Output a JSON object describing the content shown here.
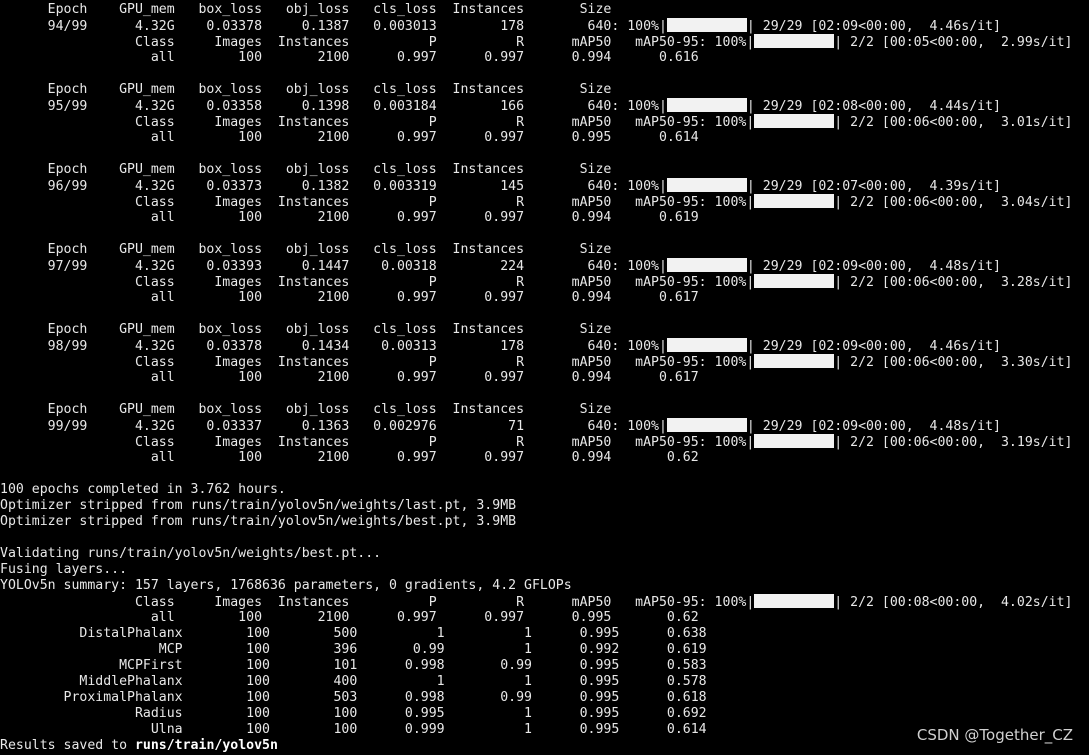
{
  "lines": [
    {
      "text": "      Epoch    GPU_mem   box_loss   obj_loss   cls_loss  Instances       Size"
    },
    {
      "text": "      94/99      4.32G    0.03378     0.1387   0.003013        178        640: 100%|",
      "bar": true,
      "suffix": "| 29/29 [02:09<00:00,  4.46s/it]"
    },
    {
      "text": "                 Class     Images  Instances          P          R      mAP50   mAP50-95: 100%|",
      "bar": true,
      "suffix": "| 2/2 [00:05<00:00,  2.99s/it]"
    },
    {
      "text": "                   all        100       2100      0.997      0.997      0.994      0.616"
    },
    {
      "text": ""
    },
    {
      "text": "      Epoch    GPU_mem   box_loss   obj_loss   cls_loss  Instances       Size"
    },
    {
      "text": "      95/99      4.32G    0.03358     0.1398   0.003184        166        640: 100%|",
      "bar": true,
      "suffix": "| 29/29 [02:08<00:00,  4.44s/it]"
    },
    {
      "text": "                 Class     Images  Instances          P          R      mAP50   mAP50-95: 100%|",
      "bar": true,
      "suffix": "| 2/2 [00:06<00:00,  3.01s/it]"
    },
    {
      "text": "                   all        100       2100      0.997      0.997      0.995      0.614"
    },
    {
      "text": ""
    },
    {
      "text": "      Epoch    GPU_mem   box_loss   obj_loss   cls_loss  Instances       Size"
    },
    {
      "text": "      96/99      4.32G    0.03373     0.1382   0.003319        145        640: 100%|",
      "bar": true,
      "suffix": "| 29/29 [02:07<00:00,  4.39s/it]"
    },
    {
      "text": "                 Class     Images  Instances          P          R      mAP50   mAP50-95: 100%|",
      "bar": true,
      "suffix": "| 2/2 [00:06<00:00,  3.04s/it]"
    },
    {
      "text": "                   all        100       2100      0.997      0.997      0.994      0.619"
    },
    {
      "text": ""
    },
    {
      "text": "      Epoch    GPU_mem   box_loss   obj_loss   cls_loss  Instances       Size"
    },
    {
      "text": "      97/99      4.32G    0.03393     0.1447    0.00318        224        640: 100%|",
      "bar": true,
      "suffix": "| 29/29 [02:09<00:00,  4.48s/it]"
    },
    {
      "text": "                 Class     Images  Instances          P          R      mAP50   mAP50-95: 100%|",
      "bar": true,
      "suffix": "| 2/2 [00:06<00:00,  3.28s/it]"
    },
    {
      "text": "                   all        100       2100      0.997      0.997      0.994      0.617"
    },
    {
      "text": ""
    },
    {
      "text": "      Epoch    GPU_mem   box_loss   obj_loss   cls_loss  Instances       Size"
    },
    {
      "text": "      98/99      4.32G    0.03378     0.1434    0.00313        178        640: 100%|",
      "bar": true,
      "suffix": "| 29/29 [02:09<00:00,  4.46s/it]"
    },
    {
      "text": "                 Class     Images  Instances          P          R      mAP50   mAP50-95: 100%|",
      "bar": true,
      "suffix": "| 2/2 [00:06<00:00,  3.30s/it]"
    },
    {
      "text": "                   all        100       2100      0.997      0.997      0.994      0.617"
    },
    {
      "text": ""
    },
    {
      "text": "      Epoch    GPU_mem   box_loss   obj_loss   cls_loss  Instances       Size"
    },
    {
      "text": "      99/99      4.32G    0.03337     0.1363   0.002976         71        640: 100%|",
      "bar": true,
      "suffix": "| 29/29 [02:09<00:00,  4.48s/it]"
    },
    {
      "text": "                 Class     Images  Instances          P          R      mAP50   mAP50-95: 100%|",
      "bar": true,
      "suffix": "| 2/2 [00:06<00:00,  3.19s/it]"
    },
    {
      "text": "                   all        100       2100      0.997      0.997      0.994       0.62"
    },
    {
      "text": ""
    },
    {
      "text": "100 epochs completed in 3.762 hours."
    },
    {
      "text": "Optimizer stripped from runs/train/yolov5n/weights/last.pt, 3.9MB"
    },
    {
      "text": "Optimizer stripped from runs/train/yolov5n/weights/best.pt, 3.9MB"
    },
    {
      "text": ""
    },
    {
      "text": "Validating runs/train/yolov5n/weights/best.pt..."
    },
    {
      "text": "Fusing layers..."
    },
    {
      "text": "YOLOv5n summary: 157 layers, 1768636 parameters, 0 gradients, 4.2 GFLOPs"
    },
    {
      "text": "                 Class     Images  Instances          P          R      mAP50   mAP50-95: 100%|",
      "bar": true,
      "suffix": "| 2/2 [00:08<00:00,  4.02s/it]"
    },
    {
      "text": "                   all        100       2100      0.997      0.997      0.995       0.62"
    },
    {
      "text": "          DistalPhalanx        100        500          1          1      0.995      0.638"
    },
    {
      "text": "                    MCP        100        396       0.99          1      0.992      0.619"
    },
    {
      "text": "               MCPFirst        100        101      0.998       0.99      0.995      0.583"
    },
    {
      "text": "          MiddlePhalanx        100        400          1          1      0.995      0.578"
    },
    {
      "text": "        ProximalPhalanx        100        503      0.998       0.99      0.995      0.618"
    },
    {
      "text": "                 Radius        100        100      0.995          1      0.995      0.692"
    },
    {
      "text": "                   Ulna        100        100      0.999          1      0.995      0.614"
    },
    {
      "text": "Results saved to ",
      "bold": "runs/train/yolov5n"
    }
  ],
  "watermark": "CSDN @Together_CZ"
}
